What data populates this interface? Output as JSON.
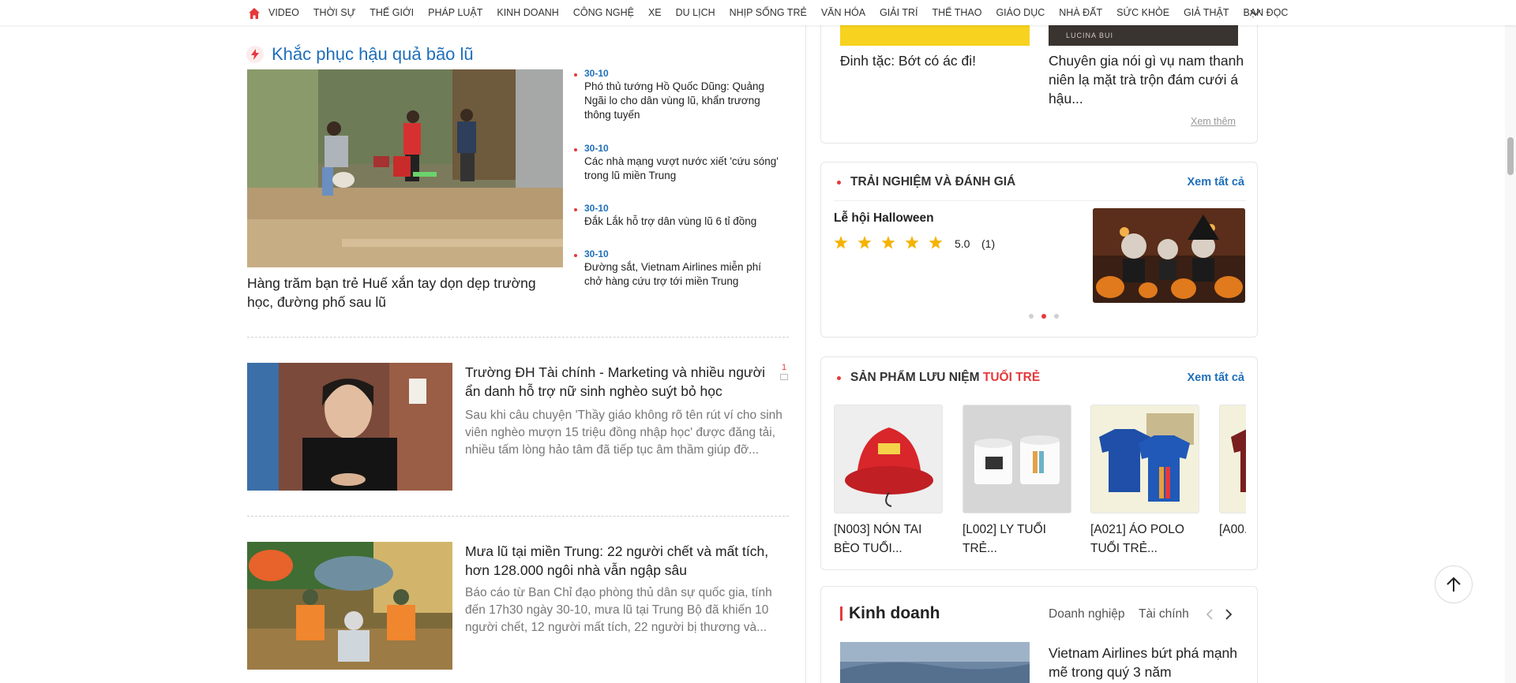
{
  "nav": {
    "items": [
      "VIDEO",
      "THỜI SỰ",
      "THẾ GIỚI",
      "PHÁP LUẬT",
      "KINH DOANH",
      "CÔNG NGHỆ",
      "XE",
      "DU LỊCH",
      "NHỊP SỐNG TRẺ",
      "VĂN HÓA",
      "GIẢI TRÍ",
      "THỂ THAO",
      "GIÁO DỤC",
      "NHÀ ĐẤT",
      "SỨC KHỎE",
      "GIẢ THẬT",
      "BẠN ĐỌC"
    ],
    "accent": "#e5393c"
  },
  "flood_section": {
    "title": "Khắc phục hậu quả bão lũ",
    "feature_caption": "Hàng trăm bạn trẻ Huế xắn tay dọn dẹp trường học, đường phố sau lũ",
    "news": [
      {
        "date": "30-10",
        "text": "Phó thủ tướng Hồ Quốc Dũng: Quảng Ngãi lo cho dân vùng lũ, khẩn trương thông tuyến"
      },
      {
        "date": "30-10",
        "text": "Các nhà mạng vượt nước xiết 'cứu sóng' trong lũ miền Trung"
      },
      {
        "date": "30-10",
        "text": "Đắk Lắk hỗ trợ dân vùng lũ 6 tỉ đồng"
      },
      {
        "date": "30-10",
        "text": "Đường sắt, Vietnam Airlines miễn phí chở hàng cứu trợ tới miền Trung"
      }
    ]
  },
  "articles": [
    {
      "title": "Trường ĐH Tài chính - Marketing và nhiều người ẩn danh hỗ trợ nữ sinh nghèo suýt bỏ học",
      "desc": "Sau khi câu chuyện 'Thầy giáo không rõ tên rút ví cho sinh viên nghèo mượn 15 triệu đồng nhập học' được đăng tải, nhiều tấm lòng hảo tâm đã tiếp tục âm thầm giúp đỡ...",
      "comments": "1"
    },
    {
      "title": "Mưa lũ tại miền Trung: 22 người chết và mất tích, hơn 128.000 ngôi nhà vẫn ngập sâu",
      "desc": "Báo cáo từ Ban Chỉ đạo phòng thủ dân sự quốc gia, tính đến 17h30 ngày 30-10, mưa lũ tại Trung Bộ đã khiến 10 người chết, 12 người mất tích, 22 người bị thương và..."
    }
  ],
  "top_card": {
    "left_title": "Đinh tặc: Bớt có ác đi!",
    "right_title": "Chuyên gia nói gì vụ nam thanh niên lạ mặt trà trộn đám cưới á hậu...",
    "image_overlay": "LUCINA BUI",
    "more": "Xem thêm"
  },
  "review_card": {
    "header": "TRẢI NGHIỆM VÀ ĐÁNH GIÁ",
    "see_all": "Xem tất cả",
    "item_title": "Lễ hội Halloween",
    "rating": "5.0",
    "rating_count": "(1)",
    "stars": 5
  },
  "souvenir_card": {
    "header_prefix": "SẢN PHẨM LƯU NIỆM",
    "header_accent": "TUỔI TRẺ",
    "see_all": "Xem tất cả",
    "products": [
      {
        "name": "[N003] NÓN TAI BÈO TUỔI..."
      },
      {
        "name": "[L002] LY TUỔI TRẺ..."
      },
      {
        "name": "[A021] ÁO POLO TUỔI TRẺ..."
      },
      {
        "name": "[A00..."
      }
    ]
  },
  "business_card": {
    "title": "Kinh doanh",
    "tabs": [
      "Doanh nghiệp",
      "Tài chính"
    ],
    "headline": "Vietnam Airlines bứt phá mạnh mẽ trong quý 3 năm"
  }
}
